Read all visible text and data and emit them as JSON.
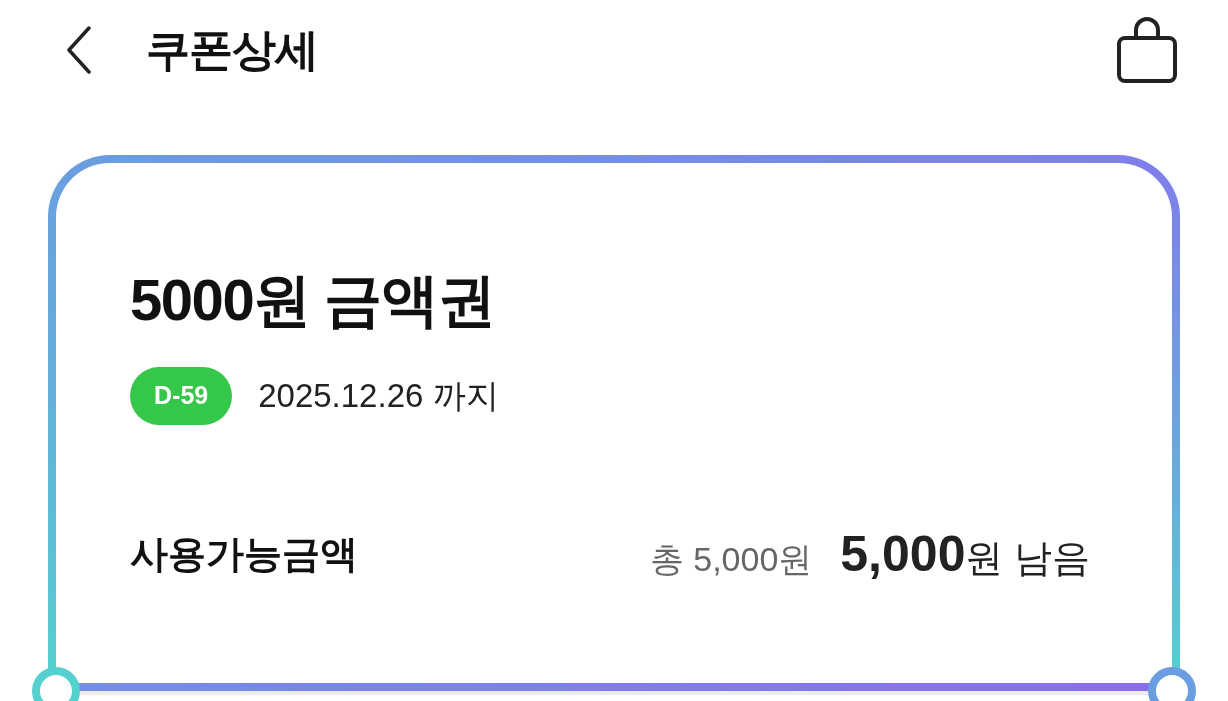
{
  "header": {
    "title": "쿠폰상세"
  },
  "coupon": {
    "name": "5000원 금액권",
    "dday_badge": "D-59",
    "expiry": "2025.12.26 까지",
    "balance_label": "사용가능금액",
    "total": "총 5,000원",
    "remaining": "**5,000**원 남음"
  }
}
